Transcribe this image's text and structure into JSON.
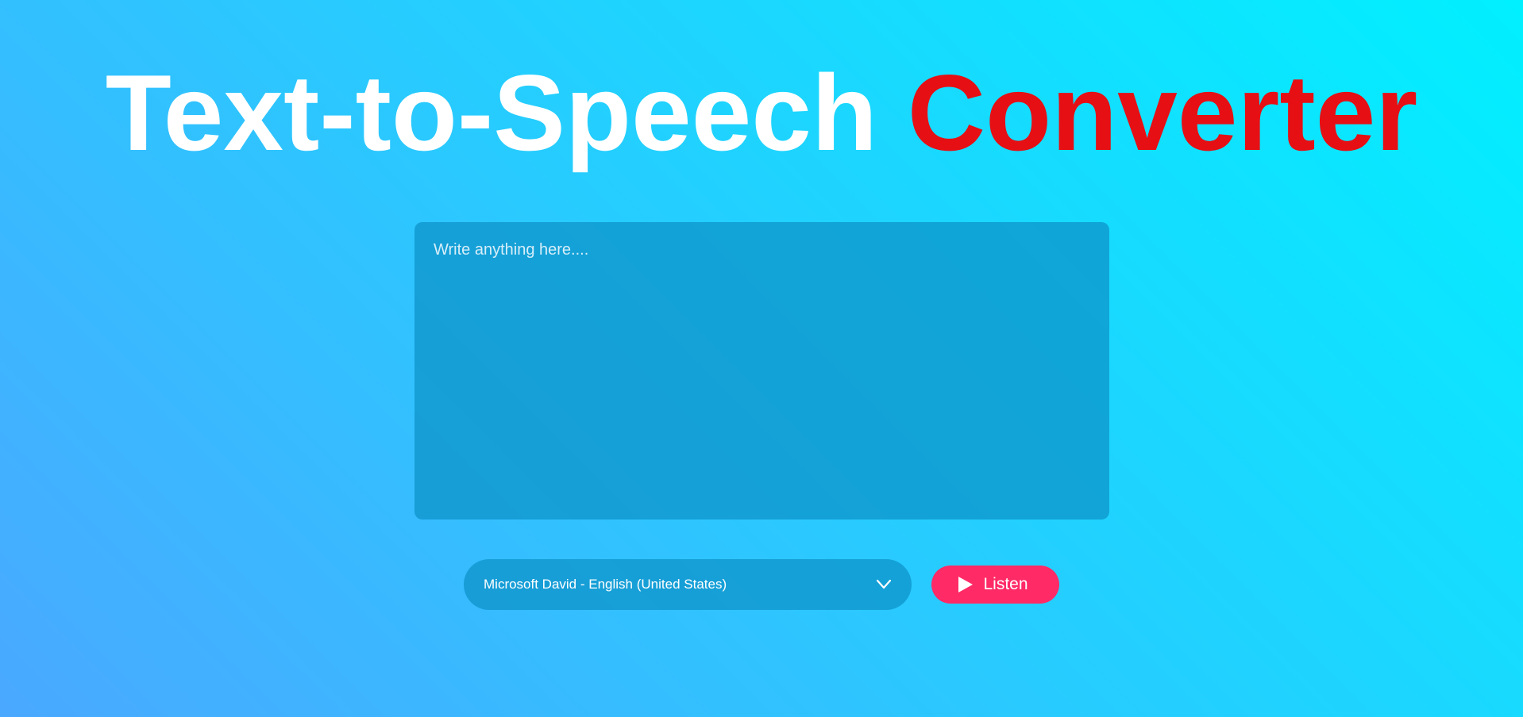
{
  "header": {
    "title_main": "Text-to-Speech",
    "title_accent": "Converter"
  },
  "editor": {
    "placeholder": "Write anything here....",
    "value": ""
  },
  "controls": {
    "voice_selected": "Microsoft David - English (United States)",
    "voice_icon": "chevron-down-icon",
    "listen_label": "Listen",
    "listen_icon": "play-icon"
  },
  "colors": {
    "title": "#ffffff",
    "accent": "#e60f14",
    "button": "#ff2a66",
    "panel": "#0d91c7"
  }
}
